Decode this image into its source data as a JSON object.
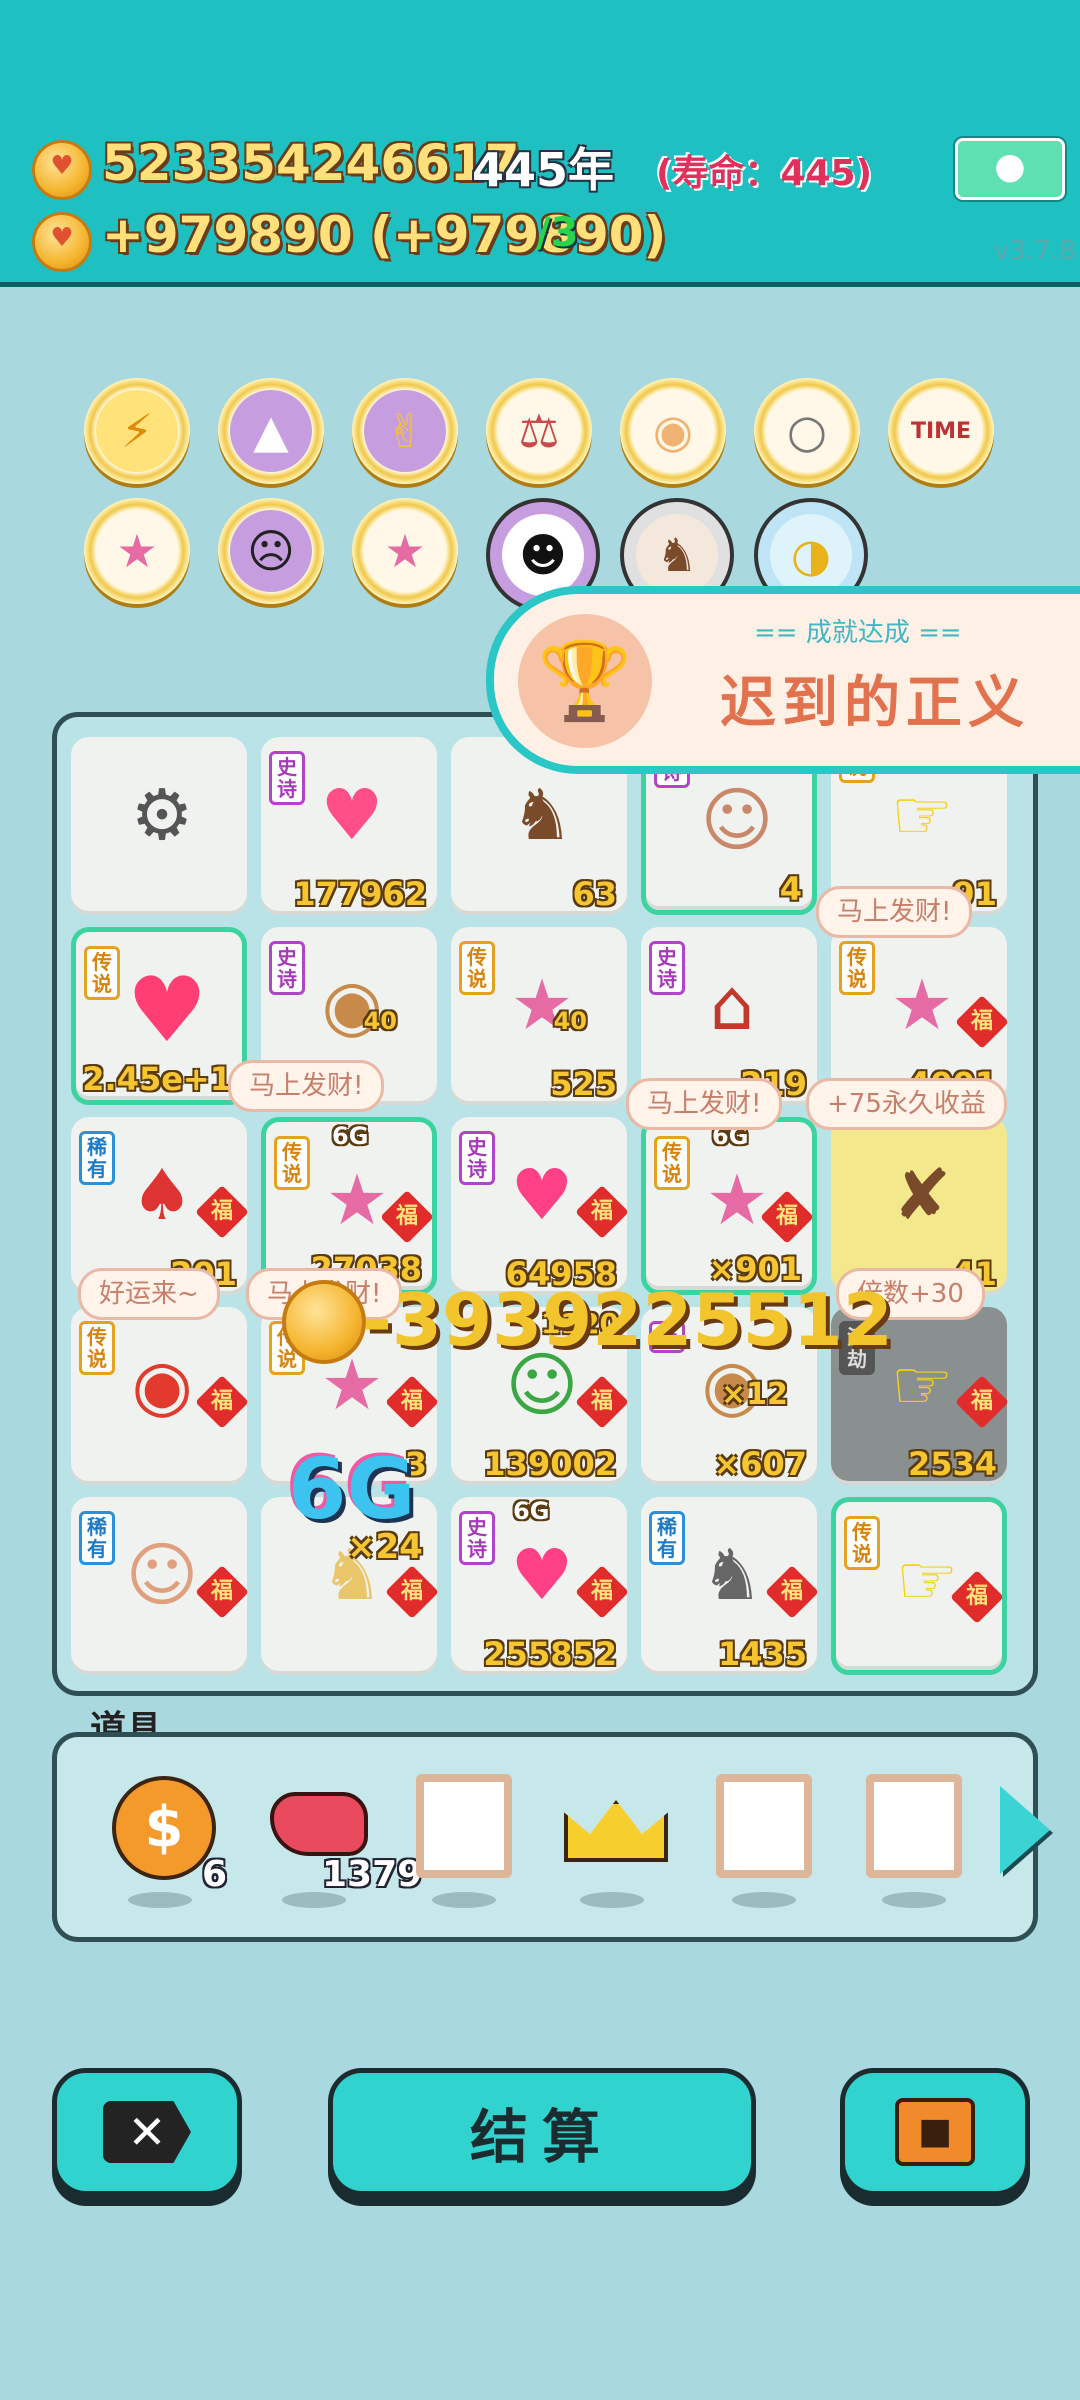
{
  "header": {
    "gold_total": "523354246617",
    "year": "445年",
    "lifespan": "(寿命：445)",
    "income_rate": "+979890 (+979890)",
    "rate_suffix": "/3",
    "version": "v3.7.8",
    "meditate_icon": "meditate-icon"
  },
  "achievement": {
    "subtitle": "== 成就达成 ==",
    "title": "迟到的正义",
    "icon": "trophy-icon"
  },
  "collection_badges": [
    {
      "icon": "lightning-icon"
    },
    {
      "icon": "skirt-icon"
    },
    {
      "icon": "rock-hand-icon"
    },
    {
      "icon": "balance-icon"
    },
    {
      "icon": "shell-icon"
    },
    {
      "icon": "husky-icon"
    },
    {
      "icon": "time-poster-icon"
    },
    {
      "icon": "unicorn-icon"
    },
    {
      "icon": "math-head-icon"
    },
    {
      "icon": "unicorn-icon"
    },
    {
      "icon": "panda-icon"
    },
    {
      "icon": "horse-icon"
    },
    {
      "icon": "duck-pot-icon"
    }
  ],
  "board": {
    "rows": [
      [
        {
          "tag": "",
          "icon": "thief-icon",
          "value": ""
        },
        {
          "tag": "史诗",
          "icon": "girl-heart-icon",
          "value": "177962"
        },
        {
          "tag": "",
          "icon": "husky-icon",
          "value": "63"
        },
        {
          "tag": "诗",
          "icon": "old-man-icon",
          "value": "4"
        },
        {
          "tag": "说",
          "icon": "pointing-hand-icon",
          "value": "91"
        }
      ],
      [
        {
          "tag": "传说",
          "icon": "heart-crown-icon",
          "value": "2.45e+1"
        },
        {
          "tag": "史诗",
          "icon": "gopher-icon",
          "value": "",
          "extra": "40"
        },
        {
          "tag": "传说",
          "icon": "unicorn-icon",
          "value": "525",
          "extra": "40"
        },
        {
          "tag": "史诗",
          "icon": "rabbit-house-icon",
          "value": "219"
        },
        {
          "tag": "传说",
          "icon": "unicorn-icon",
          "value": "4001"
        }
      ],
      [
        {
          "tag": "稀有",
          "icon": "rabbit-icon",
          "value": "201"
        },
        {
          "tag": "传说",
          "icon": "unicorn-icon",
          "value": "27038",
          "extra": "6G"
        },
        {
          "tag": "史诗",
          "icon": "hearts-girl-icon",
          "value": "64958"
        },
        {
          "tag": "传说",
          "icon": "unicorn-icon",
          "value": "×901",
          "extra": "6G"
        },
        {
          "tag": "",
          "icon": "cat-icon",
          "value": "41"
        }
      ],
      [
        {
          "tag": "传说",
          "icon": "koi-fish-icon",
          "value": ""
        },
        {
          "tag": "传说",
          "icon": "unicorn-icon",
          "value": "3"
        },
        {
          "tag": "",
          "icon": "glasses-man-icon",
          "value": "139002",
          "extra": "1120"
        },
        {
          "tag": "诗",
          "icon": "gopher-icon",
          "value": "×607",
          "extra": "×12"
        },
        {
          "tag": "渡劫",
          "icon": "pointing-hand-icon",
          "value": "2534"
        }
      ],
      [
        {
          "tag": "稀有",
          "icon": "bald-man-icon",
          "value": ""
        },
        {
          "tag": "",
          "icon": "dog-icon",
          "value": "",
          "extra": "×24"
        },
        {
          "tag": "史诗",
          "icon": "crowned-girl-icon",
          "value": "255852",
          "extra": "6G"
        },
        {
          "tag": "稀有",
          "icon": "husky-icon",
          "value": "1435"
        },
        {
          "tag": "传说",
          "icon": "crown-hand-icon",
          "value": ""
        }
      ]
    ]
  },
  "bubbles": {
    "b1": "马上发财!",
    "b2": "马上发财!",
    "b3": "马上发财!",
    "b4": "+75永久收益",
    "b5": "好运来~",
    "b6": "马上发财!",
    "b7": "倍数+30"
  },
  "floating": {
    "gold_change": "-3939225512",
    "six_g": "6G"
  },
  "tools": {
    "label": "道具",
    "items": [
      {
        "icon": "dollar-coin-icon",
        "count": "6"
      },
      {
        "icon": "liver-icon",
        "count": "1379"
      },
      {
        "icon": "empty-slot",
        "count": ""
      },
      {
        "icon": "crown-icon",
        "count": ""
      },
      {
        "icon": "empty-slot",
        "count": ""
      },
      {
        "icon": "empty-slot",
        "count": ""
      }
    ]
  },
  "buttons": {
    "close_icon": "close-icon",
    "settle_label": "结算",
    "bag_icon": "briefcase-icon"
  }
}
